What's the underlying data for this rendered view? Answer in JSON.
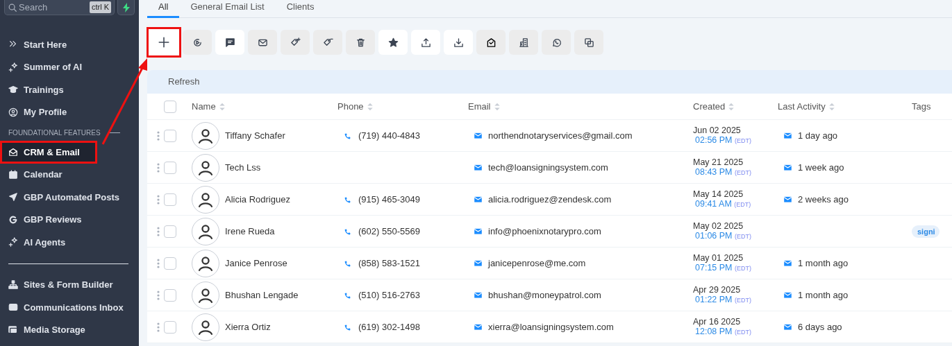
{
  "sidebar": {
    "search": {
      "placeholder": "Search",
      "shortcut": "ctrl K"
    },
    "sections": [
      {
        "items": [
          {
            "label": "Start Here",
            "selected": false,
            "highlighted": false
          },
          {
            "label": "Summer of AI",
            "selected": false,
            "highlighted": false
          },
          {
            "label": "Trainings",
            "selected": false,
            "highlighted": false
          },
          {
            "label": "My Profile",
            "selected": false,
            "highlighted": false
          }
        ]
      },
      {
        "heading": "FOUNDATIONAL FEATURES",
        "items": [
          {
            "label": "CRM & Email",
            "selected": true,
            "highlighted": true
          },
          {
            "label": "Calendar",
            "selected": false,
            "highlighted": false
          },
          {
            "label": "GBP Automated Posts",
            "selected": false,
            "highlighted": false
          },
          {
            "label": "GBP Reviews",
            "selected": false,
            "highlighted": false
          },
          {
            "label": "AI Agents",
            "selected": false,
            "highlighted": false
          }
        ]
      },
      {
        "items": [
          {
            "label": "Sites & Form Builder",
            "selected": false,
            "highlighted": false
          },
          {
            "label": "Communications Inbox",
            "selected": false,
            "highlighted": false
          },
          {
            "label": "Media Storage",
            "selected": false,
            "highlighted": false
          }
        ]
      }
    ]
  },
  "tabs": [
    {
      "label": "All",
      "selected": true
    },
    {
      "label": "General Email List",
      "selected": false
    },
    {
      "label": "Clients",
      "selected": false
    }
  ],
  "toolbar": [
    {
      "disabled": false,
      "highlighted": true
    },
    {
      "disabled": true,
      "highlighted": false
    },
    {
      "disabled": false,
      "highlighted": false
    },
    {
      "disabled": true,
      "highlighted": false
    },
    {
      "disabled": true,
      "highlighted": false
    },
    {
      "disabled": true,
      "highlighted": false
    },
    {
      "disabled": true,
      "highlighted": false
    },
    {
      "disabled": false,
      "highlighted": false
    },
    {
      "disabled": false,
      "highlighted": false
    },
    {
      "disabled": false,
      "highlighted": false
    },
    {
      "disabled": true,
      "highlighted": false
    },
    {
      "disabled": true,
      "highlighted": false
    },
    {
      "disabled": true,
      "highlighted": false
    },
    {
      "disabled": true,
      "highlighted": false
    }
  ],
  "refresh": "Refresh",
  "table": {
    "select_all_checked": false,
    "columns": [
      {
        "label": "Name",
        "sortable": true
      },
      {
        "label": "Phone",
        "sortable": true
      },
      {
        "label": "Email",
        "sortable": true
      },
      {
        "label": "Created",
        "sortable": true
      },
      {
        "label": "Last Activity",
        "sortable": true
      },
      {
        "label": "Tags",
        "sortable": false
      }
    ],
    "rows": [
      {
        "selected": false,
        "name": "Tiffany Schafer",
        "phone": "(719) 440-4843",
        "email": "northendnotaryservices@gmail.com",
        "created_date": "Jun 02 2025",
        "created_time": "02:56 PM",
        "timezone": "(EDT)",
        "last_activity": "1 day ago"
      },
      {
        "selected": false,
        "name": "Tech Lss",
        "email": "tech@loansigningsystem.com",
        "created_date": "May 21 2025",
        "created_time": "08:43 PM",
        "timezone": "(EDT)",
        "last_activity": "1 week ago"
      },
      {
        "selected": false,
        "name": "Alicia Rodriguez",
        "phone": "(915) 465-3049",
        "email": "alicia.rodriguez@zendesk.com",
        "created_date": "May 14 2025",
        "created_time": "09:41 AM",
        "timezone": "(EDT)",
        "last_activity": "2 weeks ago"
      },
      {
        "selected": false,
        "name": "Irene Rueda",
        "phone": "(602) 550-5569",
        "email": "info@phoenixnotarypro.com",
        "created_date": "May 02 2025",
        "created_time": "01:06 PM",
        "timezone": "(EDT)",
        "tag": "signi"
      },
      {
        "selected": false,
        "name": "Janice Penrose",
        "phone": "(858) 583-1521",
        "email": "janicepenrose@me.com",
        "created_date": "May 01 2025",
        "created_time": "07:15 PM",
        "timezone": "(EDT)",
        "last_activity": "1 month ago"
      },
      {
        "selected": false,
        "name": "Bhushan Lengade",
        "phone": "(510) 516-2763",
        "email": "bhushan@moneypatrol.com",
        "created_date": "Apr 29 2025",
        "created_time": "01:22 PM",
        "timezone": "(EDT)",
        "last_activity": "1 month ago"
      },
      {
        "selected": false,
        "name": "Xierra Ortiz",
        "phone": "(619) 302-1498",
        "email": "xierra@loansigningsystem.com",
        "created_date": "Apr 16 2025",
        "created_time": "12:08 PM",
        "timezone": "(EDT)",
        "last_activity": "6 days ago"
      }
    ]
  }
}
